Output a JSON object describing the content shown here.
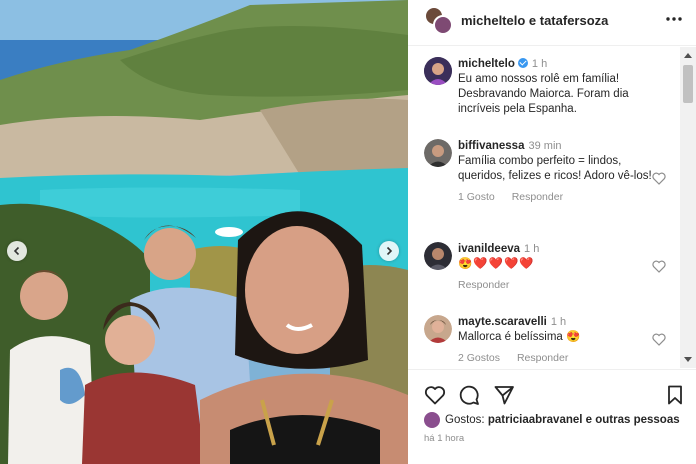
{
  "header": {
    "title": "micheltelo e tatafersoza",
    "more_icon": "more-horizontal-icon"
  },
  "caption": {
    "user": "micheltelo",
    "verified": true,
    "time": "1 h",
    "text": "Eu amo nossos rolê em família! Desbravando Maiorca. Foram dia incríveis pela Espanha."
  },
  "comments": [
    {
      "user": "biffivanessa",
      "time": "39 min",
      "text": "Família combo perfeito = lindos, queridos, felizes e ricos! Adoro vê-los!",
      "likes": "1 Gosto",
      "reply": "Responder"
    },
    {
      "user": "ivanildeeva",
      "time": "1 h",
      "text": "😍❤️❤️❤️❤️",
      "reply": "Responder"
    },
    {
      "user": "mayte.scaravelli",
      "time": "1 h",
      "text": "Mallorca é belíssima 😍",
      "likes": "2 Gostos",
      "reply": "Responder"
    }
  ],
  "likes_summary": {
    "prefix": "Gostos: ",
    "bold": "patriciaabravanel e outras pessoas"
  },
  "post_time": "há 1 hora",
  "colors": {
    "sea": "#2fc4d0",
    "sky": "#8cbfe3",
    "verified": "#3897f0",
    "text": "#262626",
    "muted": "#8e8e8e"
  }
}
